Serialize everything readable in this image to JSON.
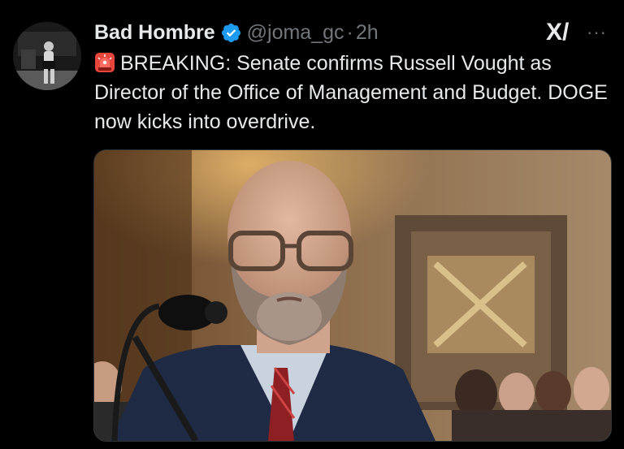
{
  "author": {
    "name": "Bad Hombre",
    "handle": "@joma_gc",
    "separator": "·",
    "time": "2h",
    "verified_icon": "verified-badge-icon",
    "avatar_icon": "profile-avatar"
  },
  "toolbar": {
    "grok_label": "X/",
    "more_label": "···"
  },
  "tweet": {
    "emoji_icon": "siren-emoji-icon",
    "text": "BREAKING: Senate confirms Russell Vought as Director of the Office of Management and Budget. DOGE now kicks into overdrive."
  },
  "media": {
    "image_icon": "photo-man-at-senate-hearing"
  },
  "colors": {
    "background": "#000000",
    "text": "#e7e9ea",
    "muted": "#71767b",
    "verified": "#1d9bf0"
  }
}
